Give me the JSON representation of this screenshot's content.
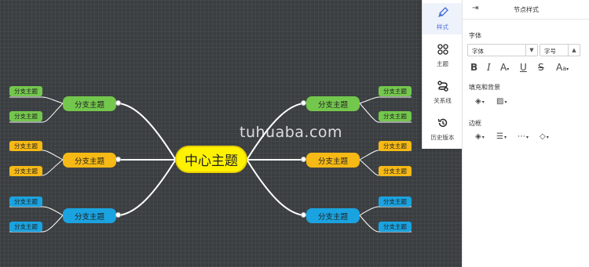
{
  "mindmap": {
    "center": "中心主题",
    "branch_label": "分支主题",
    "leaf_label": "分支主题",
    "watermark": "tuhuaba.com",
    "colors": {
      "center": "#fff200",
      "green": "#74c74d",
      "orange": "#f6b915",
      "blue": "#1aa3e0",
      "canvas": "#3a3e40"
    }
  },
  "toolbar": {
    "items": [
      {
        "label": "样式",
        "icon": "brush-icon"
      },
      {
        "label": "主题",
        "icon": "theme-grid-icon"
      },
      {
        "label": "关系线",
        "icon": "relation-line-icon"
      },
      {
        "label": "历史版本",
        "icon": "history-icon"
      }
    ]
  },
  "panel": {
    "title": "节点样式",
    "font_section": "字体",
    "font_family": "字体",
    "font_size": "字号",
    "fill_section": "填充和背景",
    "border_section": "边框",
    "accent": "#4a6fd8"
  }
}
